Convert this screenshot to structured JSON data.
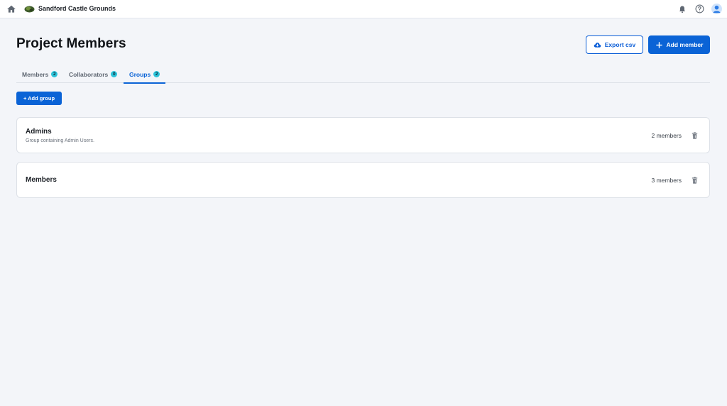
{
  "topbar": {
    "project_name": "Sandford Castle Grounds"
  },
  "header": {
    "title": "Project Members",
    "export_label": "Export csv",
    "add_member_label": "Add member"
  },
  "tabs": [
    {
      "label": "Members",
      "count": "2",
      "active": false
    },
    {
      "label": "Collaborators",
      "count": "0",
      "active": false
    },
    {
      "label": "Groups",
      "count": "2",
      "active": true
    }
  ],
  "add_group_label": "+ Add group",
  "groups": [
    {
      "name": "Admins",
      "description": "Group containing Admin Users.",
      "member_count": "2 members"
    },
    {
      "name": "Members",
      "description": "",
      "member_count": "3 members"
    }
  ],
  "colors": {
    "accent": "#0a63d6",
    "badge": "#2cc3d9",
    "background": "#f3f5f9"
  },
  "icons": [
    "home-icon",
    "project-thumbnail",
    "bell-icon",
    "help-icon",
    "avatar-icon",
    "cloud-download-icon",
    "plus-icon",
    "trash-icon"
  ]
}
